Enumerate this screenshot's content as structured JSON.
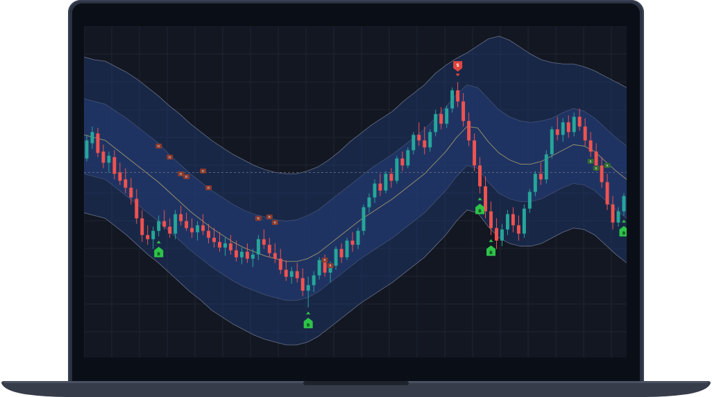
{
  "colors": {
    "background": "#131722",
    "band_fill": "#1f3566",
    "band_inner_fill": "#243e78",
    "band_line": "#8d96a8",
    "mid_line": "#b3a66d",
    "bull": "#26a69a",
    "bear": "#ef5350",
    "buy_marker": "#2ec44a",
    "sell_marker": "#e0453e",
    "warn_tag": "#8c3a2b",
    "ok_tag": "#2f6b2e",
    "grid": "#1e2433",
    "dash_line": "#5c6478"
  },
  "markers": {
    "buy_label": "B",
    "sell_label": "S",
    "warn_label": "R",
    "ok_label": "R"
  },
  "chart_data": {
    "type": "candlestick",
    "title": "",
    "xlabel": "",
    "ylabel": "",
    "grid": true,
    "indicator": "volatility bands (outer, inner, mid)",
    "ohlc": [
      [
        95,
        112,
        93,
        108
      ],
      [
        106,
        118,
        102,
        114
      ],
      [
        113,
        117,
        96,
        99
      ],
      [
        100,
        105,
        88,
        92
      ],
      [
        92,
        100,
        85,
        97
      ],
      [
        96,
        101,
        80,
        84
      ],
      [
        85,
        92,
        76,
        79
      ],
      [
        80,
        88,
        70,
        74
      ],
      [
        74,
        81,
        62,
        67
      ],
      [
        66,
        73,
        48,
        52
      ],
      [
        52,
        58,
        35,
        40
      ],
      [
        40,
        47,
        33,
        37
      ],
      [
        37,
        46,
        30,
        43
      ],
      [
        43,
        54,
        39,
        50
      ],
      [
        50,
        58,
        44,
        46
      ],
      [
        46,
        52,
        38,
        41
      ],
      [
        41,
        58,
        37,
        55
      ],
      [
        55,
        61,
        47,
        50
      ],
      [
        50,
        56,
        43,
        45
      ],
      [
        45,
        52,
        38,
        42
      ],
      [
        42,
        50,
        36,
        47
      ],
      [
        47,
        55,
        40,
        43
      ],
      [
        43,
        48,
        34,
        38
      ],
      [
        38,
        45,
        31,
        35
      ],
      [
        35,
        42,
        28,
        31
      ],
      [
        31,
        38,
        25,
        34
      ],
      [
        34,
        40,
        26,
        29
      ],
      [
        29,
        36,
        21,
        24
      ],
      [
        24,
        31,
        19,
        28
      ],
      [
        28,
        34,
        20,
        23
      ],
      [
        23,
        30,
        17,
        26
      ],
      [
        26,
        40,
        22,
        37
      ],
      [
        37,
        44,
        30,
        33
      ],
      [
        33,
        38,
        24,
        27
      ],
      [
        27,
        34,
        20,
        23
      ],
      [
        23,
        30,
        12,
        15
      ],
      [
        15,
        22,
        7,
        10
      ],
      [
        10,
        17,
        5,
        14
      ],
      [
        14,
        20,
        6,
        9
      ],
      [
        9,
        16,
        -4,
        0
      ],
      [
        0,
        10,
        -12,
        4
      ],
      [
        4,
        14,
        -1,
        11
      ],
      [
        11,
        24,
        8,
        22
      ],
      [
        22,
        26,
        10,
        13
      ],
      [
        13,
        21,
        6,
        18
      ],
      [
        18,
        32,
        15,
        30
      ],
      [
        30,
        34,
        20,
        24
      ],
      [
        24,
        38,
        22,
        36
      ],
      [
        36,
        42,
        28,
        33
      ],
      [
        33,
        45,
        30,
        43
      ],
      [
        43,
        62,
        40,
        60
      ],
      [
        60,
        70,
        56,
        67
      ],
      [
        67,
        80,
        63,
        77
      ],
      [
        77,
        84,
        68,
        72
      ],
      [
        72,
        86,
        70,
        84
      ],
      [
        84,
        88,
        74,
        79
      ],
      [
        79,
        97,
        77,
        95
      ],
      [
        95,
        100,
        86,
        90
      ],
      [
        90,
        103,
        88,
        101
      ],
      [
        101,
        114,
        98,
        112
      ],
      [
        112,
        121,
        104,
        108
      ],
      [
        108,
        118,
        98,
        103
      ],
      [
        103,
        116,
        100,
        114
      ],
      [
        114,
        130,
        111,
        127
      ],
      [
        127,
        132,
        116,
        120
      ],
      [
        120,
        133,
        117,
        131
      ],
      [
        131,
        146,
        128,
        144
      ],
      [
        144,
        150,
        132,
        136
      ],
      [
        136,
        142,
        118,
        122
      ],
      [
        122,
        128,
        104,
        108
      ],
      [
        108,
        113,
        86,
        90
      ],
      [
        90,
        96,
        70,
        75
      ],
      [
        75,
        82,
        52,
        57
      ],
      [
        57,
        64,
        40,
        45
      ],
      [
        45,
        52,
        30,
        36
      ],
      [
        36,
        48,
        32,
        44
      ],
      [
        44,
        58,
        40,
        55
      ],
      [
        55,
        60,
        42,
        47
      ],
      [
        47,
        54,
        36,
        41
      ],
      [
        41,
        62,
        38,
        59
      ],
      [
        59,
        73,
        56,
        71
      ],
      [
        71,
        86,
        68,
        84
      ],
      [
        84,
        92,
        76,
        80
      ],
      [
        80,
        101,
        77,
        98
      ],
      [
        98,
        118,
        95,
        116
      ],
      [
        116,
        125,
        108,
        112
      ],
      [
        112,
        124,
        107,
        121
      ],
      [
        121,
        126,
        110,
        114
      ],
      [
        114,
        128,
        111,
        125
      ],
      [
        125,
        131,
        115,
        118
      ],
      [
        118,
        124,
        104,
        108
      ],
      [
        108,
        114,
        96,
        100
      ],
      [
        100,
        106,
        86,
        90
      ],
      [
        90,
        96,
        74,
        78
      ],
      [
        78,
        84,
        58,
        62
      ],
      [
        62,
        68,
        44,
        49
      ],
      [
        49,
        60,
        46,
        57
      ],
      [
        57,
        70,
        54,
        68
      ]
    ],
    "bands": {
      "outer_upper": [
        168,
        166,
        165,
        161,
        157,
        152,
        146,
        140,
        133,
        127,
        120,
        114,
        108,
        103,
        98,
        94,
        90,
        87,
        85,
        84,
        84,
        86,
        89,
        94,
        100,
        107,
        113,
        119,
        124,
        129,
        136,
        142,
        148,
        156,
        162,
        167,
        171,
        176,
        181,
        183,
        180,
        175,
        170,
        166,
        164,
        163,
        163,
        161,
        158,
        154,
        150,
        146
      ],
      "inner_upper": [
        138,
        136,
        134,
        129,
        124,
        118,
        112,
        106,
        98,
        91,
        84,
        78,
        72,
        67,
        62,
        58,
        55,
        53,
        51,
        50,
        51,
        54,
        58,
        64,
        70,
        76,
        82,
        88,
        93,
        98,
        104,
        110,
        116,
        124,
        132,
        141,
        148,
        146,
        138,
        130,
        125,
        122,
        121,
        122,
        124,
        128,
        131,
        129,
        124,
        117,
        110,
        104
      ],
      "mid": [
        112,
        110,
        108,
        102,
        96,
        90,
        84,
        78,
        71,
        64,
        57,
        51,
        45,
        40,
        35,
        31,
        28,
        25,
        23,
        21,
        21,
        23,
        27,
        33,
        39,
        45,
        51,
        56,
        61,
        66,
        72,
        78,
        84,
        92,
        100,
        110,
        118,
        117,
        107,
        99,
        94,
        91,
        91,
        93,
        97,
        101,
        105,
        104,
        100,
        93,
        86,
        80
      ],
      "inner_lower": [
        84,
        82,
        80,
        74,
        68,
        62,
        56,
        50,
        43,
        36,
        29,
        23,
        17,
        12,
        7,
        3,
        0,
        -3,
        -5,
        -7,
        -7,
        -5,
        -1,
        5,
        11,
        17,
        23,
        28,
        33,
        38,
        44,
        50,
        56,
        64,
        72,
        82,
        90,
        88,
        78,
        70,
        66,
        64,
        64,
        66,
        70,
        74,
        77,
        76,
        72,
        65,
        58,
        52
      ],
      "outer_lower": [
        56,
        54,
        52,
        46,
        40,
        33,
        26,
        20,
        13,
        6,
        -1,
        -7,
        -14,
        -19,
        -24,
        -28,
        -32,
        -35,
        -37,
        -39,
        -39,
        -37,
        -33,
        -27,
        -21,
        -15,
        -9,
        -4,
        1,
        6,
        12,
        18,
        24,
        32,
        40,
        50,
        58,
        56,
        46,
        38,
        34,
        32,
        32,
        34,
        38,
        42,
        45,
        44,
        40,
        33,
        26,
        20
      ]
    },
    "signals": [
      {
        "type": "buy",
        "index": 13
      },
      {
        "type": "buy",
        "index": 40
      },
      {
        "type": "sell",
        "index": 67
      },
      {
        "type": "buy",
        "index": 71
      },
      {
        "type": "buy",
        "index": 73
      },
      {
        "type": "buy",
        "index": 97
      }
    ],
    "tags": [
      {
        "type": "warn",
        "index": 13,
        "value": 104
      },
      {
        "type": "warn",
        "index": 15,
        "value": 96
      },
      {
        "type": "warn",
        "index": 17,
        "value": 84
      },
      {
        "type": "warn",
        "index": 18,
        "value": 82
      },
      {
        "type": "warn",
        "index": 21,
        "value": 86
      },
      {
        "type": "warn",
        "index": 22,
        "value": 74
      },
      {
        "type": "warn",
        "index": 31,
        "value": 52
      },
      {
        "type": "warn",
        "index": 33,
        "value": 53
      },
      {
        "type": "warn",
        "index": 34,
        "value": 49
      },
      {
        "type": "warn",
        "index": 43,
        "value": 22
      },
      {
        "type": "warn",
        "index": 44,
        "value": 18
      },
      {
        "type": "ok",
        "index": 91,
        "value": 93
      },
      {
        "type": "ok",
        "index": 92,
        "value": 88
      },
      {
        "type": "ok",
        "index": 94,
        "value": 90
      }
    ],
    "reference_line": 85,
    "ylim": [
      -48,
      190
    ]
  }
}
